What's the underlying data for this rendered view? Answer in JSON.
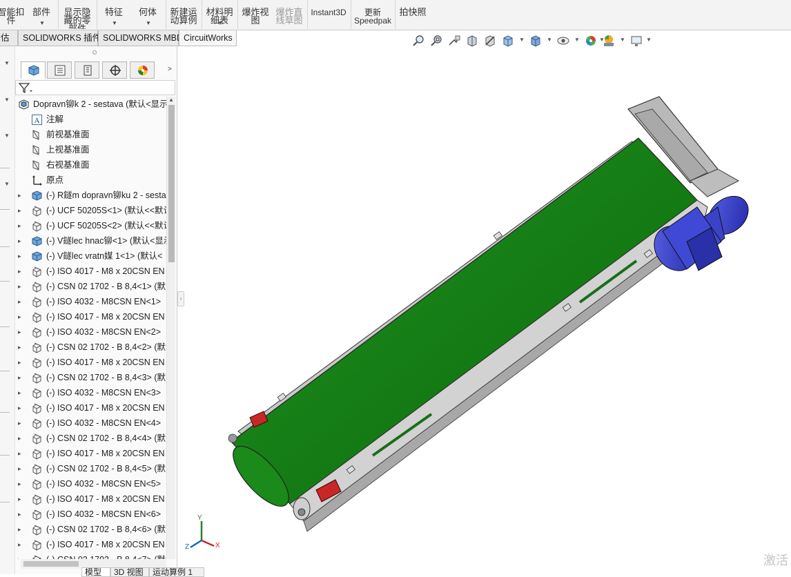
{
  "ribbon": {
    "buttons": [
      {
        "label": "智能扣\n件"
      },
      {
        "label": "部件",
        "dropdown": true
      },
      {
        "label": "显示隐\n藏的零\n部件"
      },
      {
        "label": "特征",
        "dropdown": true
      },
      {
        "label": "何体",
        "dropdown": true
      },
      {
        "label": "新建运\n动算例"
      },
      {
        "label": "材料明\n细表",
        "dropdown": true
      },
      {
        "label": "爆炸视\n图",
        "dropdown": true
      },
      {
        "label": "爆炸直\n线草图"
      },
      {
        "label": "Instant3D"
      },
      {
        "label": "更新\nSpeedpak"
      },
      {
        "label": "拍快照"
      }
    ]
  },
  "tabs": [
    "估",
    "SOLIDWORKS 插件",
    "SOLIDWORKS MBD",
    "CircuitWorks"
  ],
  "view_toolbar": {
    "icons": [
      "zoom-to-fit-icon",
      "zoom-area-icon",
      "previous-view-icon",
      "section-view-icon",
      "dynamic-annotation-icon",
      "view-orientation-icon",
      "display-style-icon",
      "hide-show-items-icon",
      "edit-appearance-icon",
      "apply-scene-icon",
      "view-settings-icon"
    ]
  },
  "feature_manager": {
    "tabs": [
      "featuremanager-tree-icon",
      "property-manager-icon",
      "configuration-manager-icon",
      "dimxpert-icon",
      "display-manager-icon"
    ],
    "tree": [
      {
        "kind": "assembly",
        "label": "Dopravn铆k 2 - sestava  (默认<显示",
        "level": 0
      },
      {
        "kind": "annotation",
        "label": "注解",
        "level": 1
      },
      {
        "kind": "plane",
        "label": "前视基准面",
        "level": 1
      },
      {
        "kind": "plane",
        "label": "上视基准面",
        "level": 1
      },
      {
        "kind": "plane",
        "label": "右视基准面",
        "level": 1
      },
      {
        "kind": "origin",
        "label": "原点",
        "level": 1
      },
      {
        "kind": "subassembly",
        "label": "(-) R鐩m dopravn铆ku 2 - sesta",
        "level": 1
      },
      {
        "kind": "part",
        "label": "(-) UCF 50205S<1> (默认<<默认",
        "level": 1
      },
      {
        "kind": "part",
        "label": "(-) UCF 50205S<2> (默认<<默认",
        "level": 1
      },
      {
        "kind": "subassembly",
        "label": "(-) V鐩lec hnac铆<1> (默认<显示",
        "level": 1
      },
      {
        "kind": "subassembly",
        "label": "(-) V鐩lec vratn媒 1<1> (默认<",
        "level": 1
      },
      {
        "kind": "part",
        "label": "(-) ISO 4017 - M8 x 20CSN EN",
        "level": 1
      },
      {
        "kind": "part",
        "label": "(-) CSN 02 1702 - B 8,4<1> (默",
        "level": 1
      },
      {
        "kind": "part",
        "label": "(-) ISO 4032 - M8CSN EN<1>",
        "level": 1
      },
      {
        "kind": "part",
        "label": "(-) ISO 4017 - M8 x 20CSN EN",
        "level": 1
      },
      {
        "kind": "part",
        "label": "(-) ISO 4032 - M8CSN EN<2>",
        "level": 1
      },
      {
        "kind": "part",
        "label": "(-) CSN 02 1702 - B 8,4<2> (默",
        "level": 1
      },
      {
        "kind": "part",
        "label": "(-) ISO 4017 - M8 x 20CSN EN",
        "level": 1
      },
      {
        "kind": "part",
        "label": "(-) CSN 02 1702 - B 8,4<3> (默",
        "level": 1
      },
      {
        "kind": "part",
        "label": "(-) ISO 4032 - M8CSN EN<3>",
        "level": 1
      },
      {
        "kind": "part",
        "label": "(-) ISO 4017 - M8 x 20CSN EN",
        "level": 1
      },
      {
        "kind": "part",
        "label": "(-) ISO 4032 - M8CSN EN<4>",
        "level": 1
      },
      {
        "kind": "part",
        "label": "(-) CSN 02 1702 - B 8,4<4> (默",
        "level": 1
      },
      {
        "kind": "part",
        "label": "(-) ISO 4017 - M8 x 20CSN EN",
        "level": 1
      },
      {
        "kind": "part",
        "label": "(-) CSN 02 1702 - B 8,4<5> (默",
        "level": 1
      },
      {
        "kind": "part",
        "label": "(-) ISO 4032 - M8CSN EN<5>",
        "level": 1
      },
      {
        "kind": "part",
        "label": "(-) ISO 4017 - M8 x 20CSN EN",
        "level": 1
      },
      {
        "kind": "part",
        "label": "(-) ISO 4032 - M8CSN EN<6>",
        "level": 1
      },
      {
        "kind": "part",
        "label": "(-) CSN 02 1702 - B 8,4<6> (默",
        "level": 1
      },
      {
        "kind": "part",
        "label": "(-) ISO 4017 - M8 x 20CSN EN",
        "level": 1
      },
      {
        "kind": "part",
        "label": "(-) CSN 02 1702 - B 8,4<7> (默",
        "level": 1
      }
    ]
  },
  "bottom_tabs": [
    "模型",
    "3D 视图",
    "运动算例 1"
  ],
  "triad": {
    "x": "X",
    "y": "Y",
    "z": "Z"
  },
  "watermark": "激活"
}
